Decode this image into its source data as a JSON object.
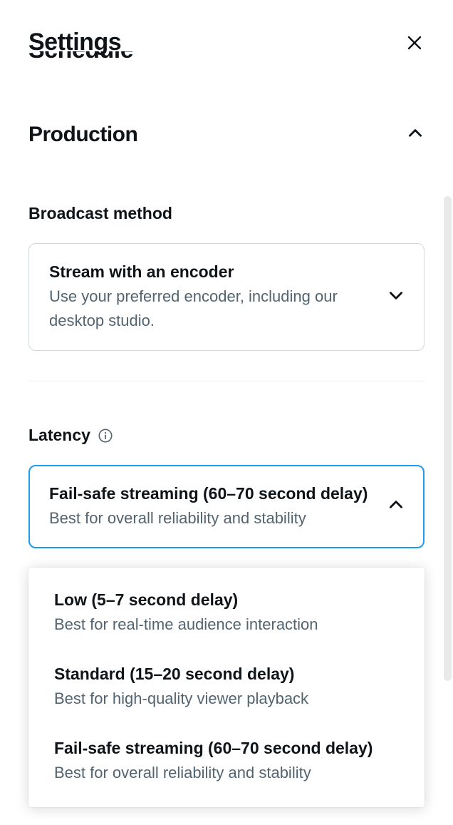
{
  "header": {
    "title": "Settings",
    "truncated_above": "Schedule"
  },
  "sections": {
    "production": {
      "title": "Production"
    }
  },
  "broadcast_method": {
    "label": "Broadcast method",
    "selected_title": "Stream with an encoder",
    "selected_desc": "Use your preferred encoder, including our desktop studio."
  },
  "latency": {
    "label": "Latency",
    "selected_title": "Fail-safe streaming (60–70 second delay)",
    "selected_desc": "Best for overall reliability and stability",
    "options": [
      {
        "title": "Low (5–7 second delay)",
        "desc": "Best for real-time audience interaction"
      },
      {
        "title": "Standard (15–20 second delay)",
        "desc": "Best for high-quality viewer playback"
      },
      {
        "title": "Fail-safe streaming (60–70 second delay)",
        "desc": "Best for overall reliability and stability"
      }
    ]
  }
}
